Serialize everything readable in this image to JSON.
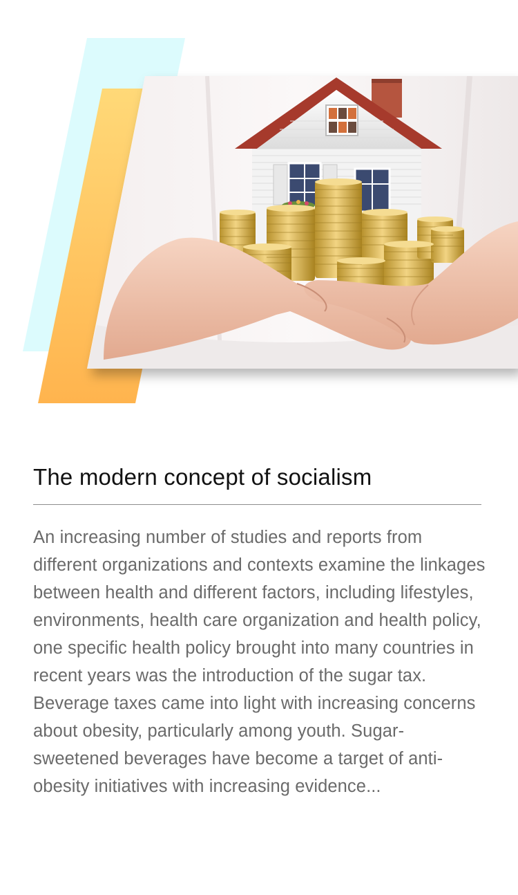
{
  "article": {
    "title": "The modern concept of socialism",
    "excerpt": "An increasing number of studies and reports from different organizations and contexts examine the linkages between health and different factors, including lifestyles, environments, health care organization and health policy, one specific health policy brought into many countries in recent years was the introduction of the sugar tax. Beverage taxes came into light with increasing concerns about obesity, particularly among youth. Sugar-sweetened beverages have become a target of anti-obesity initiatives with increasing evidence..."
  },
  "colors": {
    "accent_cyan": "#dcfbfd",
    "accent_orange": "#ffb44e",
    "accent_yellow": "#ffd978",
    "title_text": "#111111",
    "body_text": "#6a6a6a",
    "divider": "#8c8c8c"
  },
  "icons": {
    "hero_image": "house-on-coins-in-hands-image"
  }
}
